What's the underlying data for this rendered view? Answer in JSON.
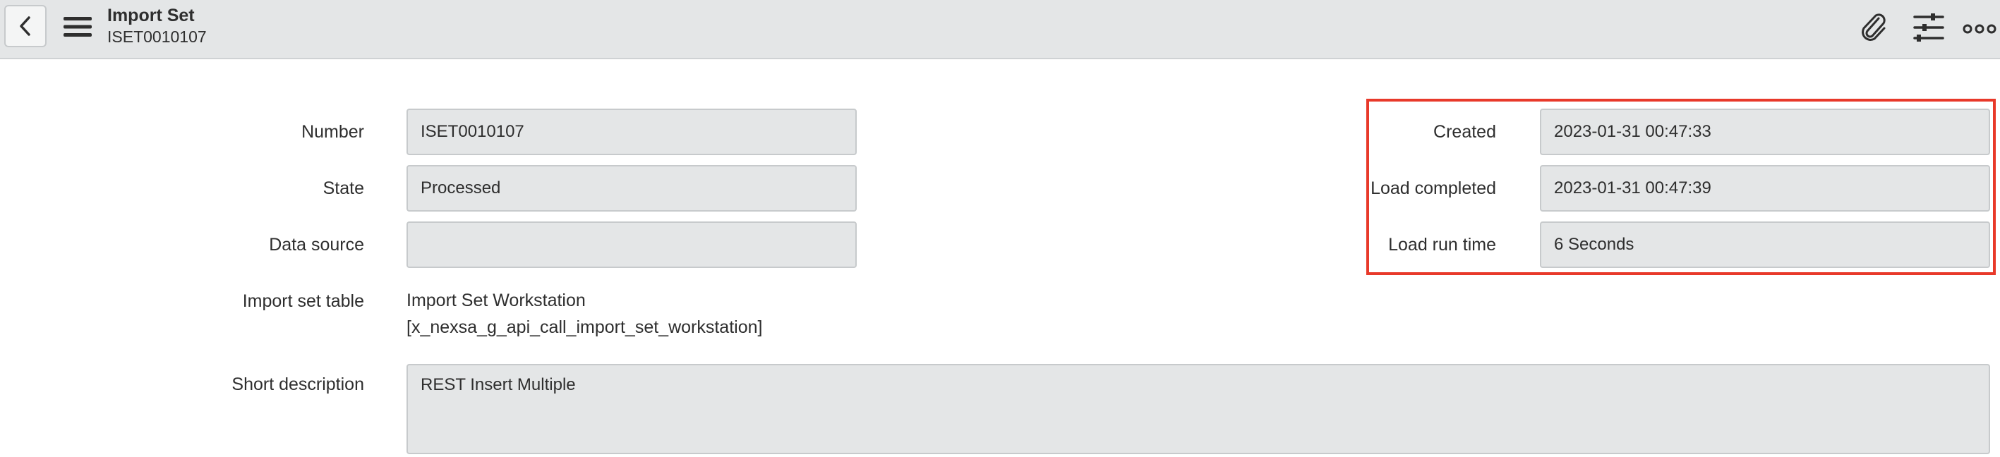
{
  "header": {
    "title": "Import Set",
    "subtitle": "ISET0010107",
    "icons": [
      "chevron-left-icon",
      "hamburger-menu-icon",
      "paperclip-icon",
      "sliders-icon",
      "more-icon"
    ]
  },
  "form": {
    "left": [
      {
        "label": "Number",
        "value": "ISET0010107"
      },
      {
        "label": "State",
        "value": "Processed"
      },
      {
        "label": "Data source",
        "value": ""
      }
    ],
    "import_set_table": {
      "label": "Import set table",
      "line1": "Import Set Workstation",
      "line2": "[x_nexsa_g_api_call_import_set_workstation]"
    },
    "short_description": {
      "label": "Short description",
      "value": "REST Insert Multiple"
    },
    "right": [
      {
        "label": "Created",
        "value": "2023-01-31 00:47:33"
      },
      {
        "label": "Load completed",
        "value": "2023-01-31 00:47:39"
      },
      {
        "label": "Load run time",
        "value": "6 Seconds"
      }
    ]
  },
  "colors": {
    "highlight": "#e8392a",
    "field_bg": "#e4e6e7",
    "header_bg": "#e4e6e7"
  }
}
